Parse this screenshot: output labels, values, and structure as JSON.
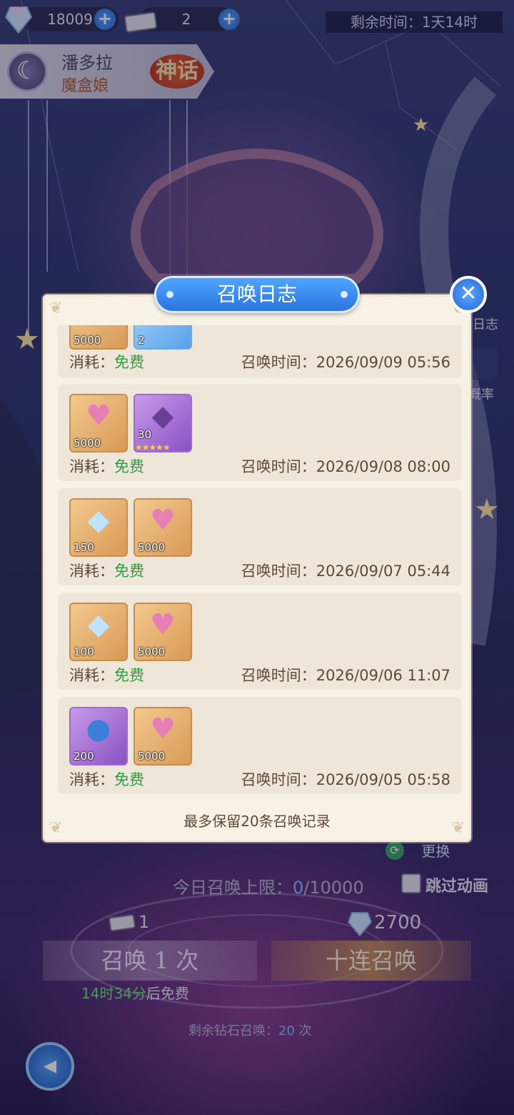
{
  "top_bar": {
    "gems": "18009",
    "tickets": "2",
    "timer_label": "剩余时间：1天14时"
  },
  "banner": {
    "name": "潘多拉",
    "subtitle": "魔盒娘",
    "rarity": "神话"
  },
  "side": {
    "log_label": "日志",
    "rate_label": "概率"
  },
  "modal": {
    "title": "召唤日志",
    "footer": "最多保留20条召唤记录",
    "records": [
      {
        "items": [
          {
            "icon": "exp-heart-icon",
            "qty": "5000",
            "glyph": "♥",
            "style": "gold"
          },
          {
            "icon": "gold-coins-icon",
            "qty": "2",
            "glyph": "◉",
            "style": "blue"
          }
        ],
        "cost_label": "消耗：",
        "cost_value": "免费",
        "time": "召唤时间：2026/09/09 05:56"
      },
      {
        "items": [
          {
            "icon": "exp-heart-icon",
            "qty": "5000",
            "glyph": "♥",
            "style": "gold"
          },
          {
            "icon": "purple-crystal-icon",
            "qty": "30",
            "glyph": "◆",
            "style": "purple",
            "stars": "★★★★★"
          }
        ],
        "cost_label": "消耗：",
        "cost_value": "免费",
        "time": "召唤时间：2026/09/08 08:00"
      },
      {
        "items": [
          {
            "icon": "diamond-icon",
            "qty": "150",
            "glyph": "◆",
            "style": "gold"
          },
          {
            "icon": "exp-heart-icon",
            "qty": "5000",
            "glyph": "♥",
            "style": "gold"
          }
        ],
        "cost_label": "消耗：",
        "cost_value": "免费",
        "time": "召唤时间：2026/09/07 05:44"
      },
      {
        "items": [
          {
            "icon": "diamond-icon",
            "qty": "100",
            "glyph": "◆",
            "style": "gold"
          },
          {
            "icon": "exp-heart-icon",
            "qty": "5000",
            "glyph": "♥",
            "style": "gold"
          }
        ],
        "cost_label": "消耗：",
        "cost_value": "免费",
        "time": "召唤时间：2026/09/06 11:07"
      },
      {
        "items": [
          {
            "icon": "crystal-ball-icon",
            "qty": "200",
            "glyph": "●",
            "style": "purple"
          },
          {
            "icon": "exp-heart-icon",
            "qty": "5000",
            "glyph": "♥",
            "style": "gold"
          }
        ],
        "cost_label": "消耗：",
        "cost_value": "免费",
        "time": "召唤时间：2026/09/05 05:58"
      }
    ]
  },
  "bottom": {
    "swap_label": "更换",
    "limit_prefix": "今日召唤上限：",
    "limit_current": "0",
    "limit_total": "/10000",
    "skip_label": "跳过动画",
    "ticket_count": "1",
    "gem_cost": "2700",
    "summon_one": "召唤 1 次",
    "summon_ten": "十连召唤",
    "free_time": "14时34分",
    "free_suffix": "后免费",
    "remain_prefix": "剩余钻石召唤：",
    "remain_count": "20",
    "remain_suffix": " 次"
  }
}
